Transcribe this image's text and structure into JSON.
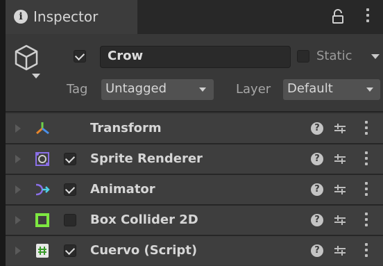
{
  "tab": {
    "info_glyph": "i",
    "title": "Inspector",
    "icons": [
      "info-icon",
      "lock-icon",
      "kebab-menu-icon"
    ]
  },
  "header": {
    "active": true,
    "name": "Crow",
    "static_label": "Static",
    "static_checked": false,
    "tag_label": "Tag",
    "tag_value": "Untagged",
    "layer_label": "Layer",
    "layer_value": "Default"
  },
  "components": [
    {
      "label": "Transform",
      "icon": "transform-icon",
      "has_checkbox": false,
      "enabled": null
    },
    {
      "label": "Sprite Renderer",
      "icon": "sprite-renderer-icon",
      "has_checkbox": true,
      "enabled": true
    },
    {
      "label": "Animator",
      "icon": "animator-icon",
      "has_checkbox": true,
      "enabled": true
    },
    {
      "label": "Box Collider 2D",
      "icon": "box-collider-icon",
      "has_checkbox": true,
      "enabled": false
    },
    {
      "label": "Cuervo (Script)",
      "icon": "script-icon",
      "has_checkbox": true,
      "enabled": true
    }
  ],
  "row_icons": {
    "help": "?",
    "help_icon": "help-icon",
    "preset_icon": "preset-icon",
    "menu_icon": "kebab-menu-icon"
  },
  "colors": {
    "background": "#383838",
    "tab_bar": "#282828",
    "row": "#3e3e3e",
    "transform_orange": "#e8862b",
    "transform_green": "#6fd14a",
    "transform_blue": "#4a8fe8",
    "sprite_purple": "#8a6fe8",
    "collider_green": "#7ee841",
    "script_green": "#9be86b"
  }
}
